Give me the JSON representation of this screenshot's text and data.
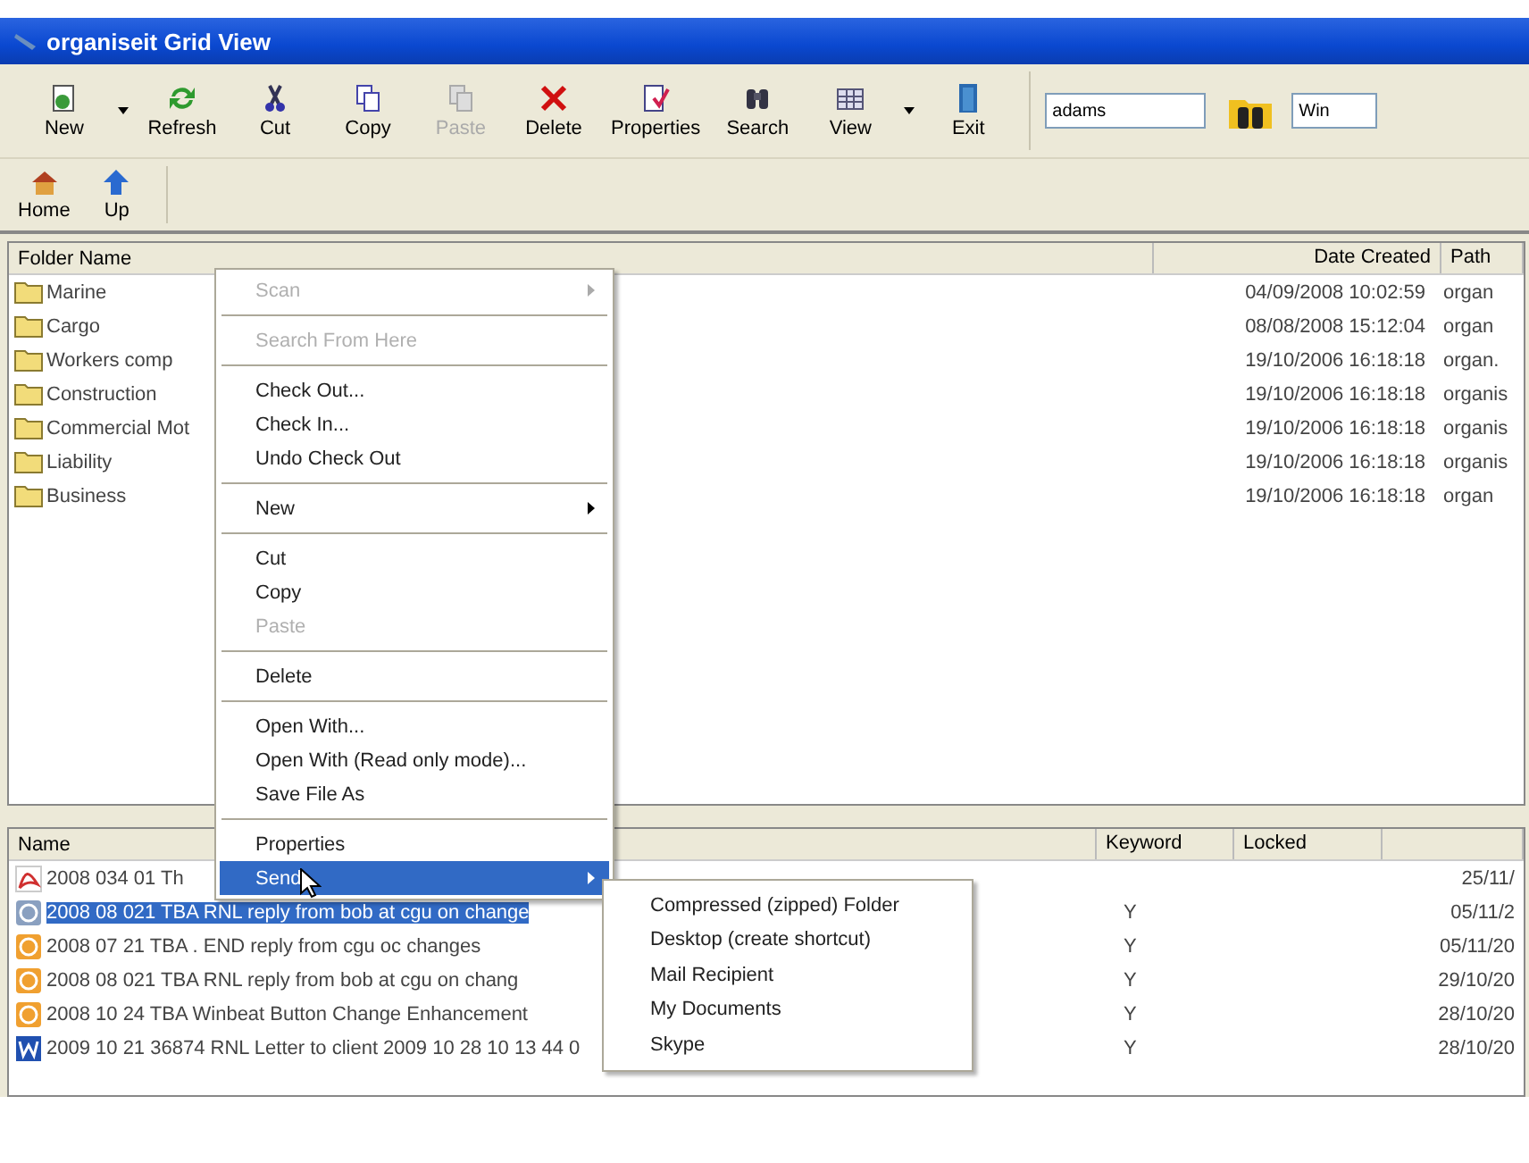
{
  "window": {
    "title": "organiseit Grid View"
  },
  "toolbar": [
    {
      "label": "New",
      "kind": "new",
      "disabled": false,
      "dropdown": true
    },
    {
      "label": "Refresh",
      "kind": "refresh",
      "disabled": false,
      "dropdown": false
    },
    {
      "label": "Cut",
      "kind": "cut",
      "disabled": false,
      "dropdown": false
    },
    {
      "label": "Copy",
      "kind": "copy",
      "disabled": false,
      "dropdown": false
    },
    {
      "label": "Paste",
      "kind": "paste",
      "disabled": true,
      "dropdown": false
    },
    {
      "label": "Delete",
      "kind": "delete",
      "disabled": false,
      "dropdown": false
    },
    {
      "label": "Properties",
      "kind": "properties",
      "disabled": false,
      "dropdown": false
    },
    {
      "label": "Search",
      "kind": "search",
      "disabled": false,
      "dropdown": false
    },
    {
      "label": "View",
      "kind": "view",
      "disabled": false,
      "dropdown": true
    },
    {
      "label": "Exit",
      "kind": "exit",
      "disabled": false,
      "dropdown": false
    }
  ],
  "search_field": {
    "value": "adams"
  },
  "second_field": {
    "value": "Win"
  },
  "toolbar_2": [
    {
      "label": "Home",
      "kind": "home"
    },
    {
      "label": "Up",
      "kind": "up"
    }
  ],
  "folders": {
    "columns": [
      "Folder Name",
      "Date Created",
      "Path"
    ],
    "rows": [
      {
        "name": "Marine",
        "date": "04/09/2008 10:02:59",
        "path": "organ"
      },
      {
        "name": "Cargo",
        "date": "08/08/2008 15:12:04",
        "path": "organ"
      },
      {
        "name": "Workers comp",
        "date": "19/10/2006 16:18:18",
        "path": "organ."
      },
      {
        "name": "Construction",
        "date": "19/10/2006 16:18:18",
        "path": "organis"
      },
      {
        "name": "Commercial Mot",
        "date": "19/10/2006 16:18:18",
        "path": "organis"
      },
      {
        "name": "Liability",
        "date": "19/10/2006 16:18:18",
        "path": "organis"
      },
      {
        "name": "Business",
        "date": "19/10/2006 16:18:18",
        "path": "organ"
      }
    ]
  },
  "files": {
    "columns": [
      "Name",
      "Keyword",
      "Locked"
    ],
    "rows": [
      {
        "kind": "pdf",
        "name": "2008 034 01 Th",
        "keyword": "",
        "date": "25/11/",
        "selected": false
      },
      {
        "kind": "mail",
        "name": "2008 08 021 TBA RNL reply from bob at cgu on change",
        "keyword": "Y",
        "date": "05/11/2",
        "selected": true
      },
      {
        "kind": "mail",
        "name": "2008 07 21 TBA . END reply from cgu oc changes",
        "keyword": "Y",
        "date": "05/11/20",
        "selected": false
      },
      {
        "kind": "mail",
        "name": "2008 08 021 TBA RNL reply from bob at cgu on chang",
        "keyword": "Y",
        "date": "29/10/20",
        "selected": false
      },
      {
        "kind": "mail",
        "name": "2008 10 24  TBA Winbeat Button Change Enhancement",
        "keyword": "Y",
        "date": "28/10/20",
        "selected": false
      },
      {
        "kind": "word",
        "name": "2009 10 21 36874 RNL Letter to client 2009 10 28 10 13 44 0",
        "keyword": "Y",
        "date": "28/10/20",
        "selected": false
      }
    ]
  },
  "context_menu": [
    {
      "kind": "item",
      "label": "Scan",
      "disabled": true,
      "submenu": true,
      "selected": false
    },
    {
      "kind": "separator"
    },
    {
      "kind": "item",
      "label": "Search From Here",
      "disabled": true,
      "submenu": false,
      "selected": false
    },
    {
      "kind": "separator"
    },
    {
      "kind": "item",
      "label": "Check Out...",
      "disabled": false,
      "submenu": false,
      "selected": false
    },
    {
      "kind": "item",
      "label": "Check In...",
      "disabled": false,
      "submenu": false,
      "selected": false
    },
    {
      "kind": "item",
      "label": "Undo Check Out",
      "disabled": false,
      "submenu": false,
      "selected": false
    },
    {
      "kind": "separator"
    },
    {
      "kind": "item",
      "label": "New",
      "disabled": false,
      "submenu": true,
      "selected": false
    },
    {
      "kind": "separator"
    },
    {
      "kind": "item",
      "label": "Cut",
      "disabled": false,
      "submenu": false,
      "selected": false
    },
    {
      "kind": "item",
      "label": "Copy",
      "disabled": false,
      "submenu": false,
      "selected": false
    },
    {
      "kind": "item",
      "label": "Paste",
      "disabled": true,
      "submenu": false,
      "selected": false
    },
    {
      "kind": "separator"
    },
    {
      "kind": "item",
      "label": "Delete",
      "disabled": false,
      "submenu": false,
      "selected": false
    },
    {
      "kind": "separator"
    },
    {
      "kind": "item",
      "label": "Open With...",
      "disabled": false,
      "submenu": false,
      "selected": false
    },
    {
      "kind": "item",
      "label": "Open With (Read only mode)...",
      "disabled": false,
      "submenu": false,
      "selected": false
    },
    {
      "kind": "item",
      "label": "Save File As",
      "disabled": false,
      "submenu": false,
      "selected": false
    },
    {
      "kind": "separator"
    },
    {
      "kind": "item",
      "label": "Properties",
      "disabled": false,
      "submenu": false,
      "selected": false
    },
    {
      "kind": "item",
      "label": "Send",
      "disabled": false,
      "submenu": true,
      "selected": true
    }
  ],
  "send_to_menu": [
    "Compressed (zipped) Folder",
    "Desktop (create shortcut)",
    "Mail Recipient",
    "My Documents",
    "Skype"
  ]
}
